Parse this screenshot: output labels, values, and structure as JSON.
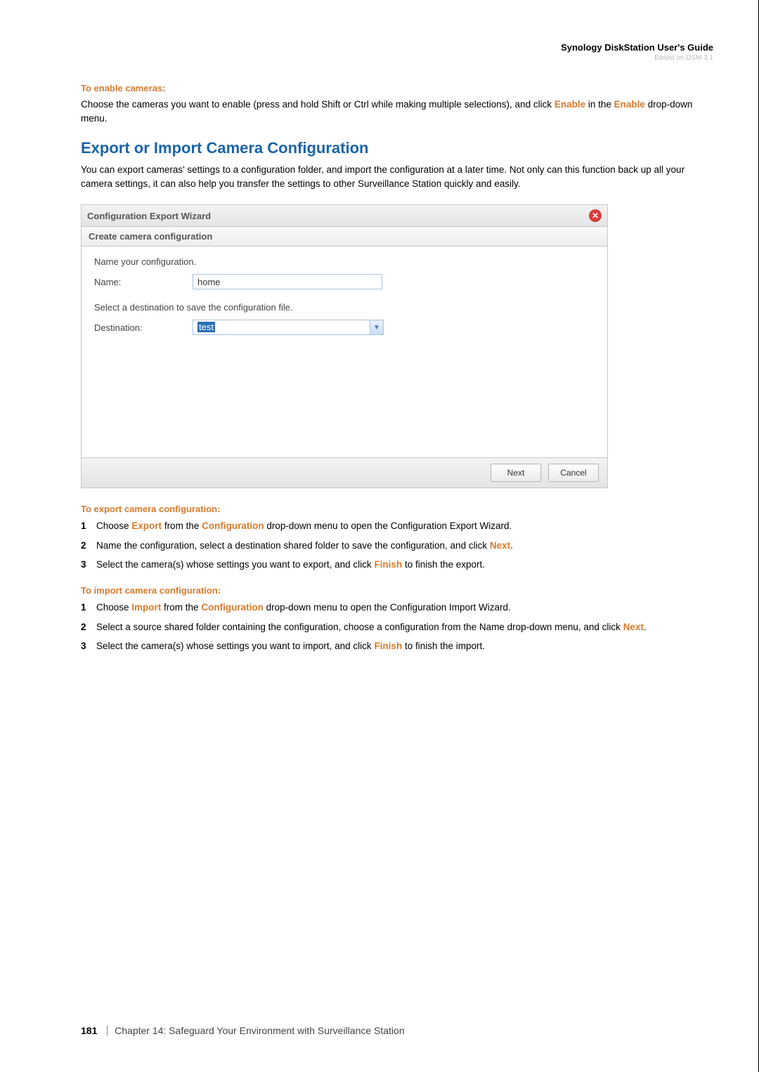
{
  "header": {
    "title": "Synology DiskStation User's Guide",
    "subtitle": "Based on DSM 3.1"
  },
  "enable_section": {
    "heading": "To enable cameras:",
    "text_before": "Choose the cameras you want to enable (press and hold Shift or Ctrl while making multiple selections), and click ",
    "word_enable1": "Enable",
    "text_mid": " in the ",
    "word_enable2": "Enable",
    "text_after": " drop-down menu."
  },
  "chapter_title": "Export or Import Camera Configuration",
  "chapter_intro": "You can export cameras' settings to a configuration folder, and import the configuration at a later time. Not only can this function back up all your camera settings, it can also help you transfer the settings to other Surveillance Station quickly and easily.",
  "wizard": {
    "title": "Configuration Export Wizard",
    "subtitle": "Create camera configuration",
    "name_instruction": "Name your configuration.",
    "name_label": "Name:",
    "name_value": "home",
    "dest_instruction": "Select a destination to save the configuration file.",
    "dest_label": "Destination:",
    "dest_value": "test",
    "btn_next": "Next",
    "btn_cancel": "Cancel"
  },
  "export_section": {
    "heading": "To export camera configuration:",
    "step1_a": "Choose ",
    "step1_export": "Export",
    "step1_b": " from the ",
    "step1_config": "Configuration",
    "step1_c": " drop-down menu to open the Configuration Export Wizard.",
    "step2_a": "Name the configuration, select a destination shared folder to save the configuration, and click ",
    "step2_next": "Next",
    "step2_b": ".",
    "step3_a": "Select the camera(s) whose settings you want to export, and click ",
    "step3_finish": "Finish",
    "step3_b": " to finish the export."
  },
  "import_section": {
    "heading": "To import camera configuration:",
    "step1_a": "Choose ",
    "step1_import": "Import",
    "step1_b": " from the ",
    "step1_config": "Configuration",
    "step1_c": " drop-down menu to open the Configuration Import Wizard.",
    "step2_a": "Select a source shared folder containing the configuration, choose a configuration from the Name drop-down menu, and click ",
    "step2_next": "Next",
    "step2_b": ".",
    "step3_a": "Select the camera(s) whose settings you want to import, and click ",
    "step3_finish": "Finish",
    "step3_b": " to finish the import."
  },
  "footer": {
    "page": "181",
    "chapter": "Chapter 14: Safeguard Your Environment with Surveillance Station"
  }
}
